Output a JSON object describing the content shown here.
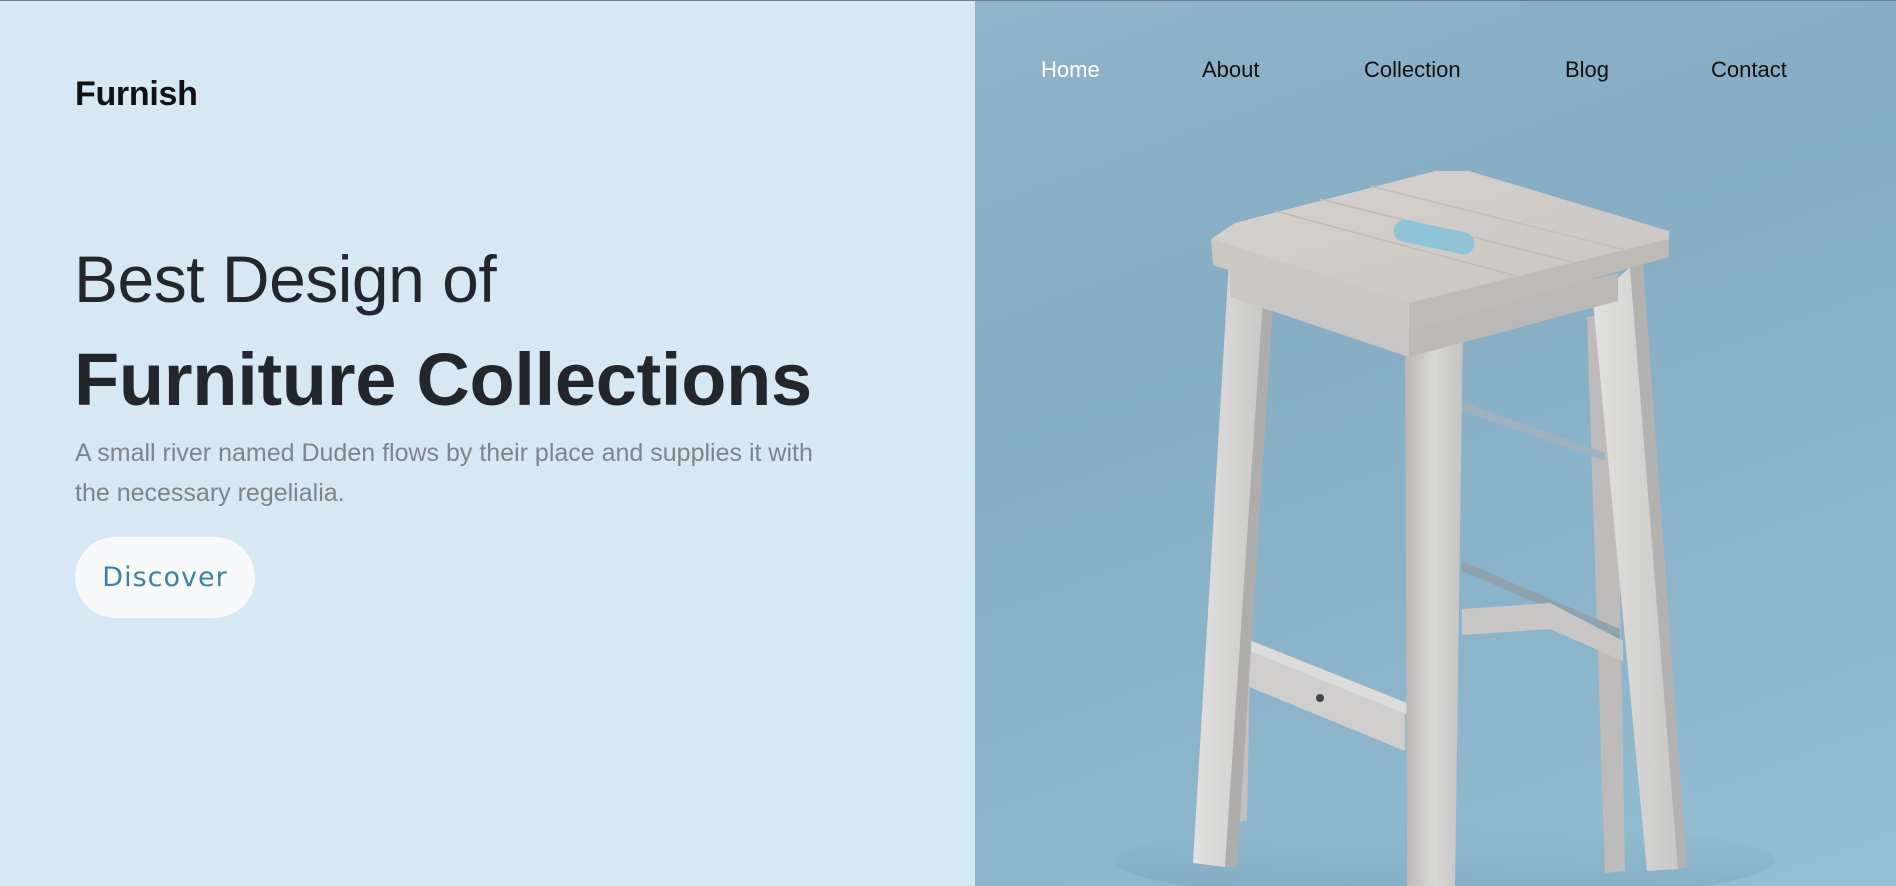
{
  "brand": {
    "name": "Furnish"
  },
  "nav": {
    "items": [
      {
        "label": "Home",
        "active": true
      },
      {
        "label": "About",
        "active": false
      },
      {
        "label": "Collection",
        "active": false
      },
      {
        "label": "Blog",
        "active": false
      },
      {
        "label": "Contact",
        "active": false
      }
    ]
  },
  "hero": {
    "headline_light": "Best Design of",
    "headline_bold": "Furniture Collections",
    "subtitle": "A small river named Duden flows by their place and supplies it with the necessary regelialia.",
    "cta_label": "Discover",
    "image": "wooden-stool-photo"
  },
  "colors": {
    "left_background": "#d5e8f4",
    "right_background": "#8cb3c9",
    "heading_text": "#23272b",
    "subtitle_text": "#7f8487",
    "cta_text": "#3b82a8",
    "cta_background": "#f7f9fa",
    "nav_active": "#ffffff",
    "nav_text": "#111111"
  }
}
